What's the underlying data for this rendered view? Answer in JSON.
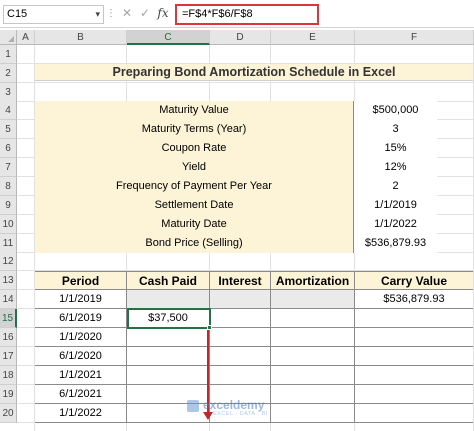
{
  "formula_bar": {
    "name_box": "C15",
    "cancel_icon": "✕",
    "enter_icon": "✓",
    "fx_label": "fx",
    "formula": "=F$4*F$6/F$8"
  },
  "columns": [
    "A",
    "B",
    "C",
    "D",
    "E",
    "F"
  ],
  "selected_column": "C",
  "rows": [
    "1",
    "2",
    "3",
    "4",
    "5",
    "6",
    "7",
    "8",
    "9",
    "10",
    "11",
    "12",
    "13",
    "14",
    "15",
    "16",
    "17",
    "18",
    "19",
    "20"
  ],
  "selected_row": "15",
  "title": "Preparing Bond Amortization Schedule in Excel",
  "info_table": [
    {
      "label": "Maturity Value",
      "value": "$500,000"
    },
    {
      "label": "Maturity Terms (Year)",
      "value": "3"
    },
    {
      "label": "Coupon Rate",
      "value": "15%"
    },
    {
      "label": "Yield",
      "value": "12%"
    },
    {
      "label": "Frequency of Payment Per Year",
      "value": "2"
    },
    {
      "label": "Settlement Date",
      "value": "1/1/2019"
    },
    {
      "label": "Maturity Date",
      "value": "1/1/2022"
    },
    {
      "label": "Bond Price (Selling)",
      "value": "$536,879.93"
    }
  ],
  "schedule": {
    "headers": [
      "Period",
      "Cash Paid",
      "Interest",
      "Amortization",
      "Carry Value"
    ],
    "rows": [
      {
        "period": "1/1/2019",
        "cash_paid": "",
        "interest": "",
        "amortization": "",
        "carry_value": "$536,879.93"
      },
      {
        "period": "6/1/2019",
        "cash_paid": "$37,500",
        "interest": "",
        "amortization": "",
        "carry_value": ""
      },
      {
        "period": "1/1/2020",
        "cash_paid": "",
        "interest": "",
        "amortization": "",
        "carry_value": ""
      },
      {
        "period": "6/1/2020",
        "cash_paid": "",
        "interest": "",
        "amortization": "",
        "carry_value": ""
      },
      {
        "period": "1/1/2021",
        "cash_paid": "",
        "interest": "",
        "amortization": "",
        "carry_value": ""
      },
      {
        "period": "6/1/2021",
        "cash_paid": "",
        "interest": "",
        "amortization": "",
        "carry_value": ""
      },
      {
        "period": "1/1/2022",
        "cash_paid": "",
        "interest": "",
        "amortization": "",
        "carry_value": ""
      }
    ]
  },
  "watermark": {
    "name": "exceldemy",
    "tagline": "EXCEL · DATA · BI"
  },
  "colors": {
    "accent_green": "#217346",
    "header_fill": "#fdf3d7",
    "formula_border": "#d9373b",
    "drag_arrow": "#c0272d"
  }
}
